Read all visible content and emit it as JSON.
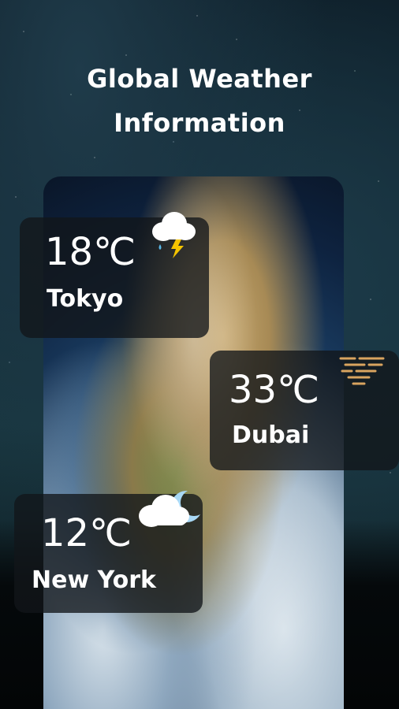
{
  "header": {
    "title_line1": "Global Weather",
    "title_line2": "Information"
  },
  "cards": [
    {
      "city": "Tokyo",
      "temperature": "18℃",
      "icon": "cloud-thunder-rain-icon"
    },
    {
      "city": "Dubai",
      "temperature": "33℃",
      "icon": "sun-haze-icon"
    },
    {
      "city": "New York",
      "temperature": "12℃",
      "icon": "cloud-moon-icon"
    }
  ],
  "colors": {
    "accent_yellow": "#f5c400",
    "rain_blue": "#58b7e8",
    "haze_orange": "#d9a45f"
  }
}
